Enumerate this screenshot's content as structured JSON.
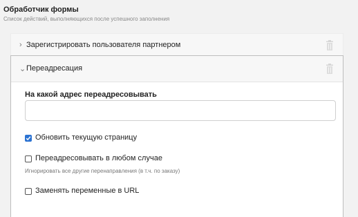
{
  "header": {
    "title": "Обработчик формы",
    "subtitle": "Список действий, выполняющихся после успешного заполнения"
  },
  "actions": [
    {
      "label": "Зарегистрировать пользователя партнером",
      "chevron": "›",
      "expanded": false,
      "icon": "trash-icon"
    },
    {
      "label": "Переадресация",
      "chevron": "⌄",
      "expanded": true,
      "icon": "trash-icon"
    }
  ],
  "redirect": {
    "address_label": "На какой адрес переадресовывать",
    "address_value": "",
    "address_placeholder": "",
    "refresh_label": "Обновить текущую страницу",
    "refresh_checked": true,
    "always_label": "Переадресовывать в любом случае",
    "always_checked": false,
    "always_hint": "Игнорировать все другие перенаправления (в т.ч. по заказу)",
    "replace_label": "Заменять переменные в URL",
    "replace_checked": false
  },
  "colors": {
    "checkbox_accent": "#2c73d2",
    "page_background": "#f2f2f2"
  }
}
